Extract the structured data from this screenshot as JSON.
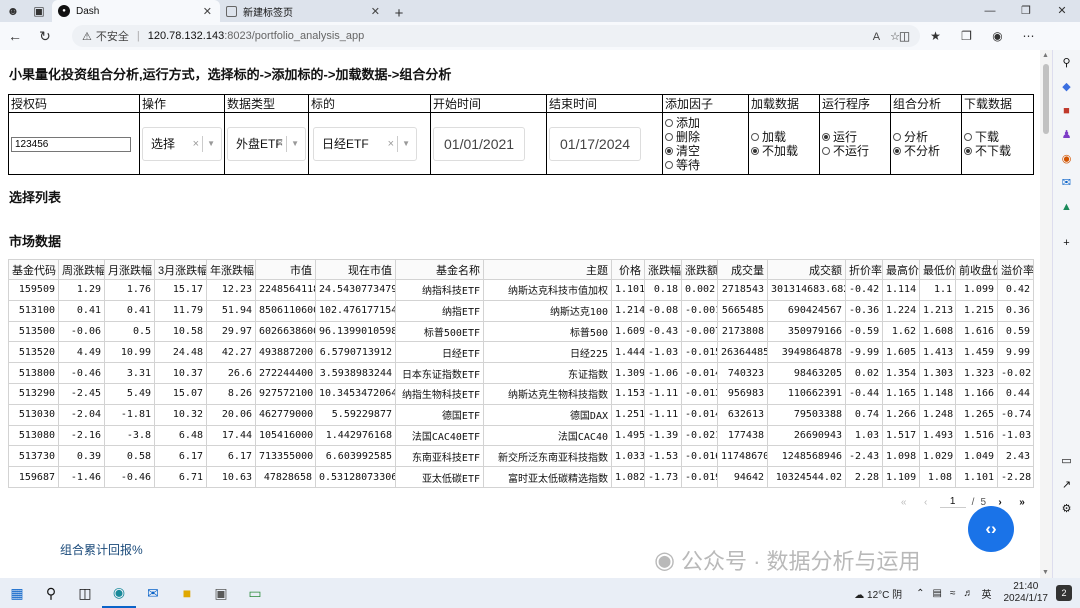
{
  "browser": {
    "tabs": [
      {
        "label": "Dash",
        "favicon": "dash-logo"
      },
      {
        "label": "新建标签页",
        "favicon": "blank-page-icon"
      }
    ],
    "address": {
      "security": "不安全",
      "host": "120.78.132.143",
      "path": ":8023/portfolio_analysis_app"
    }
  },
  "page": {
    "title": "小果量化投资组合分析,运行方式，选择标的->添加标的->加载数据->组合分析",
    "controls": {
      "headers": [
        "授权码",
        "操作",
        "数据类型",
        "标的",
        "开始时间",
        "结束时间",
        "添加因子",
        "加载数据",
        "运行程序",
        "组合分析",
        "下载数据"
      ],
      "auth_code": "123456",
      "operation": "选择",
      "data_type": "外盘ETF",
      "target": "日经ETF",
      "start_date": "01/01/2021",
      "end_date": "01/17/2024",
      "factor_options": [
        {
          "label": "添加",
          "checked": false
        },
        {
          "label": "删除",
          "checked": false
        },
        {
          "label": "清空",
          "checked": true
        },
        {
          "label": "等待",
          "checked": false
        }
      ],
      "load_options": [
        {
          "label": "加载",
          "checked": false
        },
        {
          "label": "不加载",
          "checked": true
        }
      ],
      "run_options": [
        {
          "label": "运行",
          "checked": true
        },
        {
          "label": "不运行",
          "checked": false
        }
      ],
      "analysis_options": [
        {
          "label": "分析",
          "checked": false
        },
        {
          "label": "不分析",
          "checked": true
        }
      ],
      "download_options": [
        {
          "label": "下载",
          "checked": false
        },
        {
          "label": "不下载",
          "checked": true
        }
      ]
    },
    "selection_title": "选择列表",
    "market_title": "市场数据",
    "market_table": {
      "columns": [
        "基金代码",
        "周涨跌幅",
        "月涨跌幅",
        "3月涨跌幅",
        "年涨跌幅",
        "市值",
        "现在市值",
        "基金名称",
        "主题",
        "价格",
        "涨跌幅",
        "涨跌额",
        "成交量",
        "成交额",
        "折价率",
        "最高价",
        "最低价",
        "前收盘价",
        "溢价率"
      ],
      "rows": [
        [
          "159509",
          "1.29",
          "1.76",
          "15.17",
          "12.23",
          "2248564118",
          "24.54307734797",
          "纳指科技ETF",
          "纳斯达克科技市值加权",
          "1.101",
          "0.18",
          "0.002",
          "2718543",
          "301314683.682",
          "-0.42",
          "1.114",
          "1.1",
          "1.099",
          "0.42"
        ],
        [
          "513100",
          "0.41",
          "0.41",
          "11.79",
          "51.94",
          "8506110600",
          "102.476177154",
          "纳指ETF",
          "纳斯达克100",
          "1.214",
          "-0.08",
          "-0.001",
          "5665485",
          "690424567",
          "-0.36",
          "1.224",
          "1.213",
          "1.215",
          "0.36"
        ],
        [
          "513500",
          "-0.06",
          "0.5",
          "10.58",
          "29.97",
          "6026638600",
          "96.1399010598",
          "标普500ETF",
          "标普500",
          "1.609",
          "-0.43",
          "-0.007",
          "2173808",
          "350979166",
          "-0.59",
          "1.62",
          "1.608",
          "1.616",
          "0.59"
        ],
        [
          "513520",
          "4.49",
          "10.99",
          "24.48",
          "42.27",
          "493887200",
          "6.5790713912",
          "日经ETF",
          "日经225",
          "1.444",
          "-1.03",
          "-0.015",
          "26364485",
          "3949864878",
          "-9.99",
          "1.605",
          "1.413",
          "1.459",
          "9.99"
        ],
        [
          "513800",
          "-0.46",
          "3.31",
          "10.37",
          "26.6",
          "272244400",
          "3.5938983244",
          "日本东证指数ETF",
          "东证指数",
          "1.309",
          "-1.06",
          "-0.014",
          "740323",
          "98463205",
          "0.02",
          "1.354",
          "1.303",
          "1.323",
          "-0.02"
        ],
        [
          "513290",
          "-2.45",
          "5.49",
          "15.07",
          "8.26",
          "927572100",
          "10.3453472064",
          "纳指生物科技ETF",
          "纳斯达克生物科技指数",
          "1.153",
          "-1.11",
          "-0.013",
          "956983",
          "110662391",
          "-0.44",
          "1.165",
          "1.148",
          "1.166",
          "0.44"
        ],
        [
          "513030",
          "-2.04",
          "-1.81",
          "10.32",
          "20.06",
          "462779000",
          "5.59229877",
          "德国ETF",
          "德国DAX",
          "1.251",
          "-1.11",
          "-0.014",
          "632613",
          "79503388",
          "0.74",
          "1.266",
          "1.248",
          "1.265",
          "-0.74"
        ],
        [
          "513080",
          "-2.16",
          "-3.8",
          "6.48",
          "17.44",
          "105416000",
          "1.442976168",
          "法国CAC40ETF",
          "法国CAC40",
          "1.495",
          "-1.39",
          "-0.021",
          "177438",
          "26690943",
          "1.03",
          "1.517",
          "1.493",
          "1.516",
          "-1.03"
        ],
        [
          "513730",
          "0.39",
          "0.58",
          "6.17",
          "6.17",
          "713355000",
          "6.603992585",
          "东南亚科技ETF",
          "新交所泛东南亚科技指数",
          "1.033",
          "-1.53",
          "-0.016",
          "11748670",
          "1248568946",
          "-2.43",
          "1.098",
          "1.029",
          "1.049",
          "2.43"
        ],
        [
          "159687",
          "-1.46",
          "-0.46",
          "6.71",
          "10.63",
          "47828658",
          "0.531280733064",
          "亚太低碳ETF",
          "富时亚太低碳精选指数",
          "1.082",
          "-1.73",
          "-0.019",
          "94642",
          "10324544.02",
          "2.28",
          "1.109",
          "1.08",
          "1.101",
          "-2.28"
        ]
      ]
    },
    "pagination": {
      "current": "1",
      "separator": "/",
      "total": "5"
    },
    "cumulative_link": "组合累计回报%",
    "watermark": "公众号 · 数据分析与运用"
  },
  "taskbar": {
    "weather": "12°C 阴",
    "ime": "英",
    "time": "21:40",
    "date": "2024/1/17",
    "notifications": "2"
  }
}
